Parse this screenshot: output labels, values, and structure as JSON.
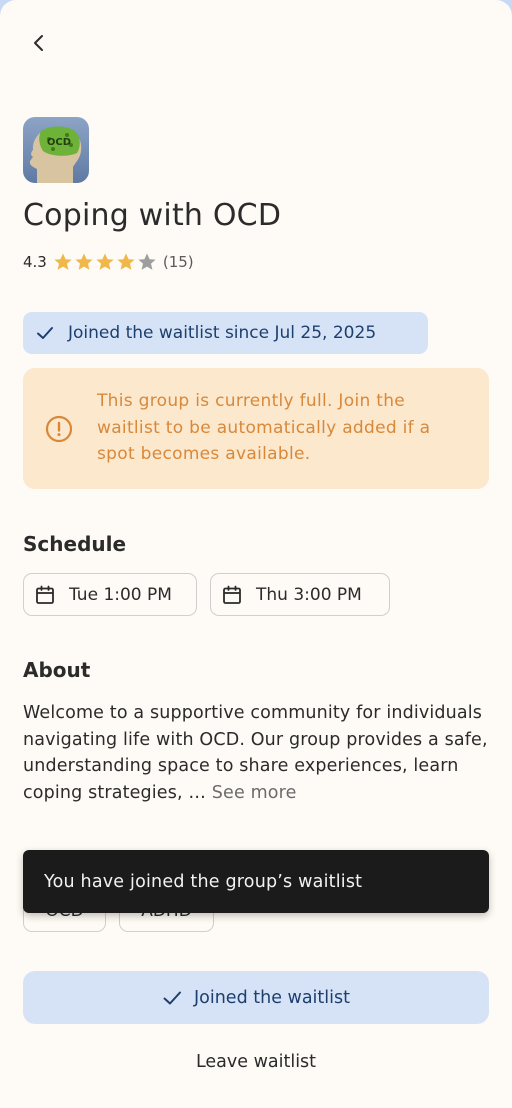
{
  "header": {
    "back_icon": "chevron-left-icon"
  },
  "group": {
    "icon_name": "ocd-head-icon",
    "icon_text": "OCD",
    "title": "Coping with OCD",
    "rating": "4.3",
    "rating_value": 4.3,
    "stars_filled": 4,
    "stars_total": 5,
    "rating_count": "(15)"
  },
  "waitlist_badge": {
    "icon": "check-icon",
    "text": "Joined the waitlist since Jul 25, 2025"
  },
  "alert": {
    "icon": "alert-circle-icon",
    "text": "This group is currently full. Join the waitlist to be automatically added if a spot becomes available."
  },
  "schedule": {
    "heading": "Schedule",
    "slots": [
      {
        "icon": "calendar-icon",
        "label": "Tue 1:00 PM"
      },
      {
        "icon": "calendar-icon",
        "label": "Thu 3:00 PM"
      }
    ]
  },
  "about": {
    "heading": "About",
    "text": "Welcome to a supportive community for individuals navigating life with OCD. Our group provides a safe, understanding space to share experiences, learn coping strategies, …",
    "see_more": "See more"
  },
  "tags": [
    "OCD",
    "ADHD"
  ],
  "toast": {
    "text": "You have joined the group’s waitlist"
  },
  "actions": {
    "primary_icon": "check-icon",
    "primary_label": "Joined the waitlist",
    "secondary_label": "Leave waitlist"
  },
  "colors": {
    "background": "#fefaf5",
    "badge_bg": "#d6e3f7",
    "badge_text": "#1d3f6e",
    "alert_bg": "#fbe8cd",
    "alert_text": "#d9883a",
    "star_filled": "#f0b84a",
    "star_empty": "#9e9e9e",
    "toast_bg": "#1b1b1b"
  }
}
